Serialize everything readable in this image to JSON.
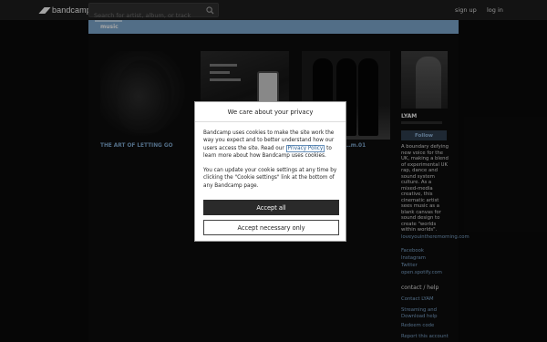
{
  "topbar": {
    "logo_text": "bandcamp",
    "search_placeholder": "Search for artist, album, or track",
    "signup_label": "sign up",
    "login_label": "log in"
  },
  "band_nav": {
    "tab_music": "music"
  },
  "albums": [
    {
      "title": "THE ART OF LETTING GO"
    },
    {
      "title": ""
    },
    {
      "title": "…m.01"
    },
    {
      "title": ""
    }
  ],
  "artist": {
    "name": "LYAM",
    "follow_label": "Follow",
    "bio": "A boundary defying new voice for the UK, making a blend of experimental UK rap, dance and sound system culture. As a mixed-media creative, this cinematic artist sees music as a blank canvas for sound design to create \"worlds within worlds\".",
    "links": [
      "loveyouintheremorning.com",
      "Facebook",
      "Instagram",
      "Twitter",
      "open.spotify.com"
    ],
    "contact_heading": "contact / help",
    "help_links": [
      "Contact LYAM",
      "Streaming and Download help",
      "Redeem code",
      "Report this account"
    ]
  },
  "cookie_dialog": {
    "title": "We care about your privacy",
    "p1_before": "Bandcamp uses cookies to make the site work the way you expect and to better understand how our users access the site. Read our ",
    "privacy_link": "Privacy Policy",
    "p1_after": " to learn more about how Bandcamp uses cookies.",
    "p2": "You can update your cookie settings at any time by clicking the \"Cookie settings\" link at the bottom of any Bandcamp page.",
    "accept_all_label": "Accept all",
    "accept_necessary_label": "Accept necessary only"
  },
  "colors": {
    "accent": "#7aa2c8",
    "page_bg": "#0a0a0a",
    "topbar_bg": "#1c1c1c",
    "button_dark": "#2a2a2a"
  }
}
